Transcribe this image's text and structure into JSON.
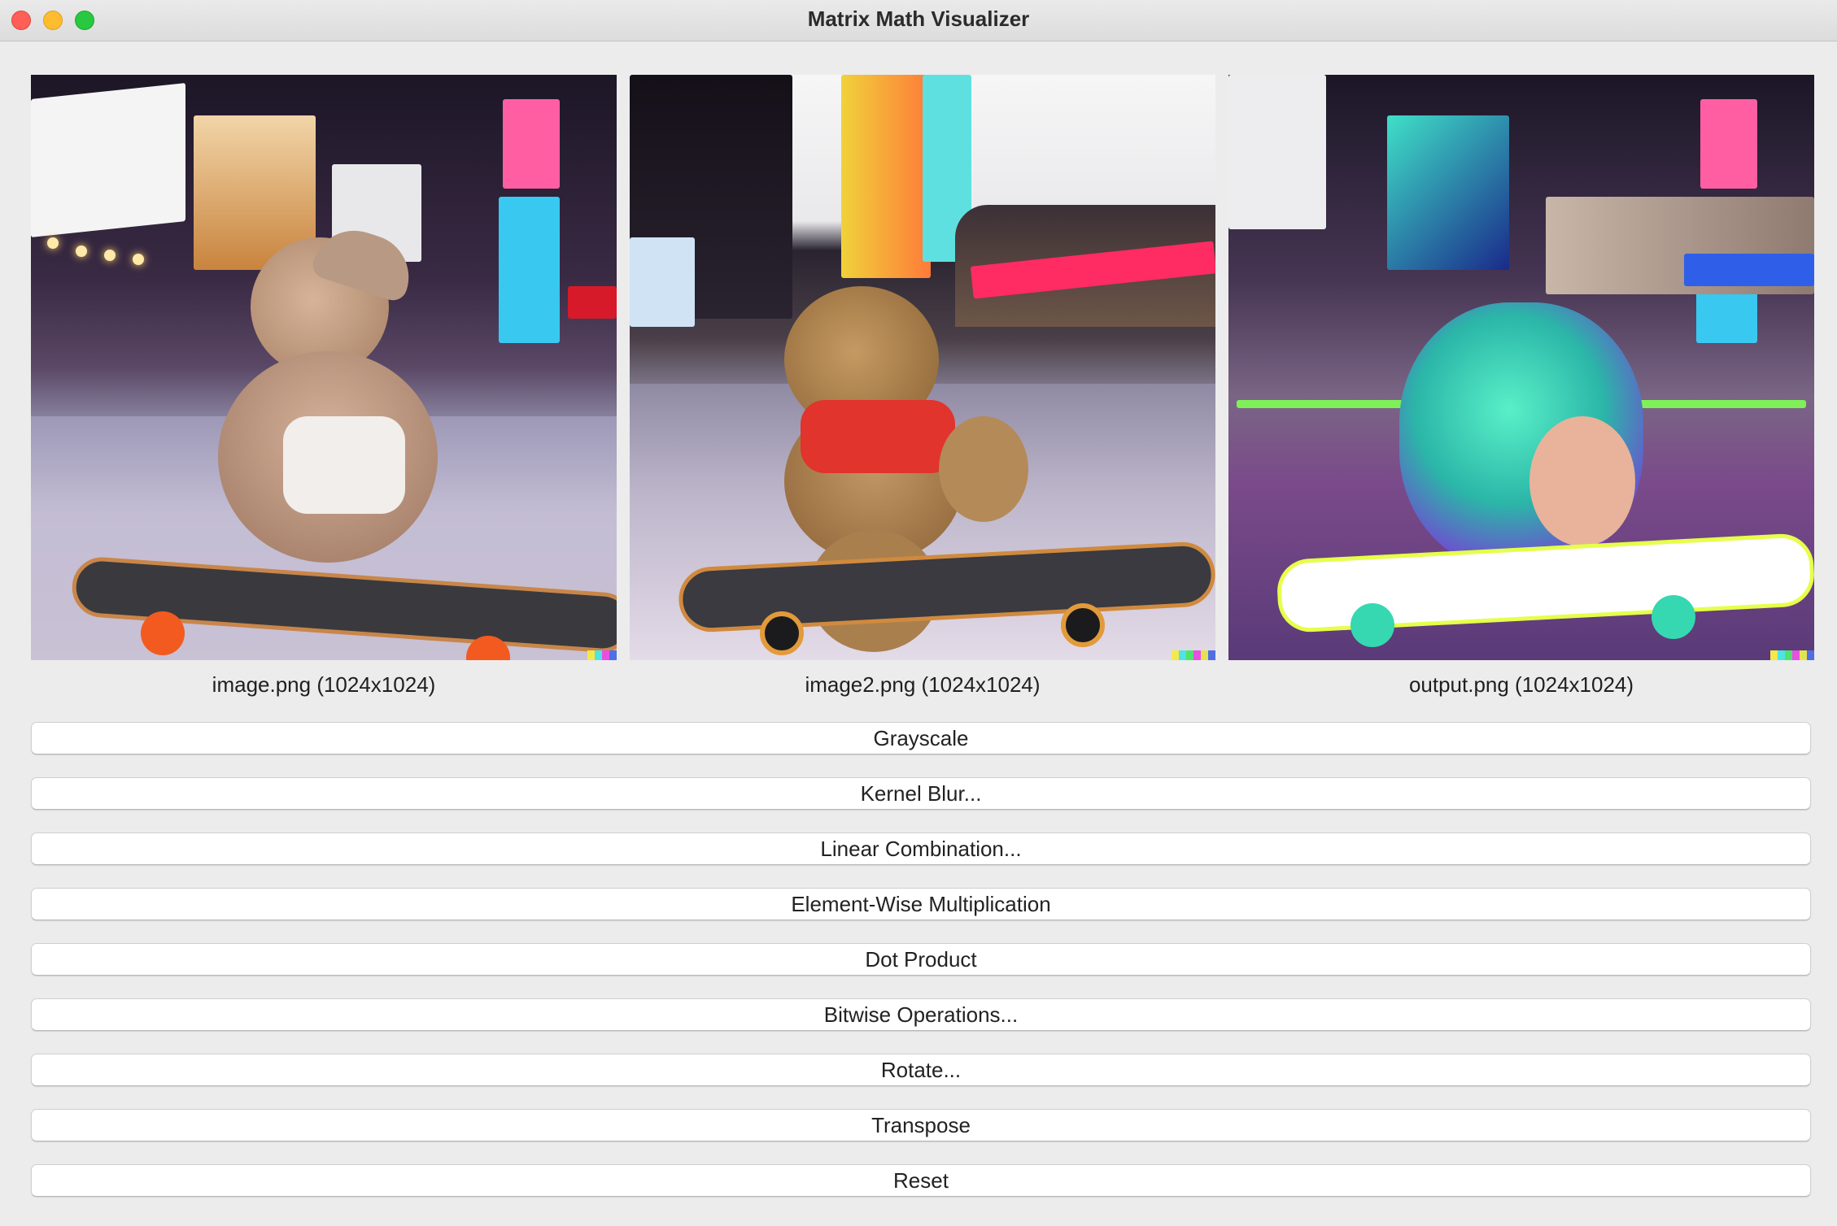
{
  "window": {
    "title": "Matrix Math Visualizer"
  },
  "images": [
    {
      "caption": "image.png (1024x1024)"
    },
    {
      "caption": "image2.png (1024x1024)"
    },
    {
      "caption": "output.png (1024x1024)"
    }
  ],
  "buttons": {
    "grayscale": "Grayscale",
    "kernel_blur": "Kernel Blur...",
    "linear_combination": "Linear Combination...",
    "elementwise_multiplication": "Element-Wise Multiplication",
    "dot_product": "Dot Product",
    "bitwise_operations": "Bitwise Operations...",
    "rotate": "Rotate...",
    "transpose": "Transpose",
    "reset": "Reset"
  },
  "colors": {
    "window_bg": "#ececec",
    "close": "#ff5f57",
    "minimize": "#febc2e",
    "maximize": "#28c840"
  }
}
